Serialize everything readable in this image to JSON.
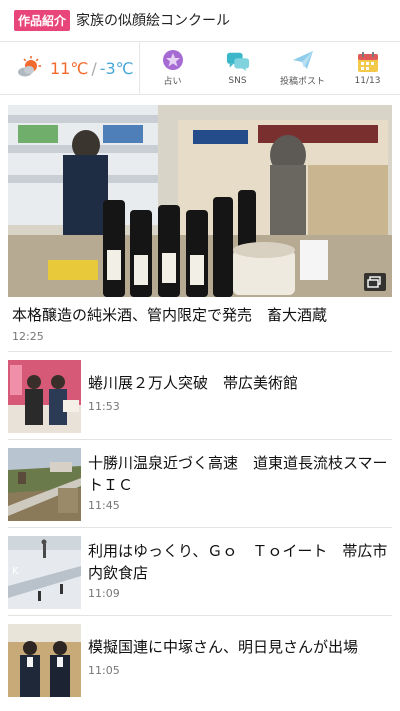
{
  "banner": {
    "tag": "作品紹介",
    "title": "家族の似顔絵コンクール"
  },
  "weather": {
    "icon": "sun-cloud-icon",
    "high": "11℃",
    "separator": "/",
    "low": "-3℃"
  },
  "toolbar": [
    {
      "icon": "fortune-star-icon",
      "label": "占い",
      "color": "#9b59b6"
    },
    {
      "icon": "chat-bubbles-icon",
      "label": "SNS",
      "color": "#3bb7c9"
    },
    {
      "icon": "paper-plane-icon",
      "label": "投稿ポスト",
      "color": "#7ec4e6"
    },
    {
      "icon": "calendar-icon",
      "label": "11/13",
      "color": "#e05a5a"
    }
  ],
  "hero": {
    "title": "本格醸造の純米酒、管内限定で発売　畜大酒蔵",
    "time": "12:25",
    "image": "sake-shop-photo",
    "badge_icon": "gallery-icon"
  },
  "news": [
    {
      "title": "蜷川展２万人突破　帯広美術館",
      "time": "11:53",
      "image": "museum-visitors-photo"
    },
    {
      "title": "十勝川温泉近づく高速　道東道長流枝スマートＩＣ",
      "time": "11:45",
      "image": "highway-aerial-photo"
    },
    {
      "title": "利用はゆっくり、Ｇｏ　Ｔｏイート　帯広市内飲食店",
      "time": "11:09",
      "image": "snow-street-photo"
    },
    {
      "title": "模擬国連に中塚さん、明日見さんが出場",
      "time": "11:05",
      "image": "students-photo"
    }
  ],
  "colors": {
    "accent": "#e8457a",
    "high_temp": "#f26a2e",
    "low_temp": "#4aa8d8"
  }
}
